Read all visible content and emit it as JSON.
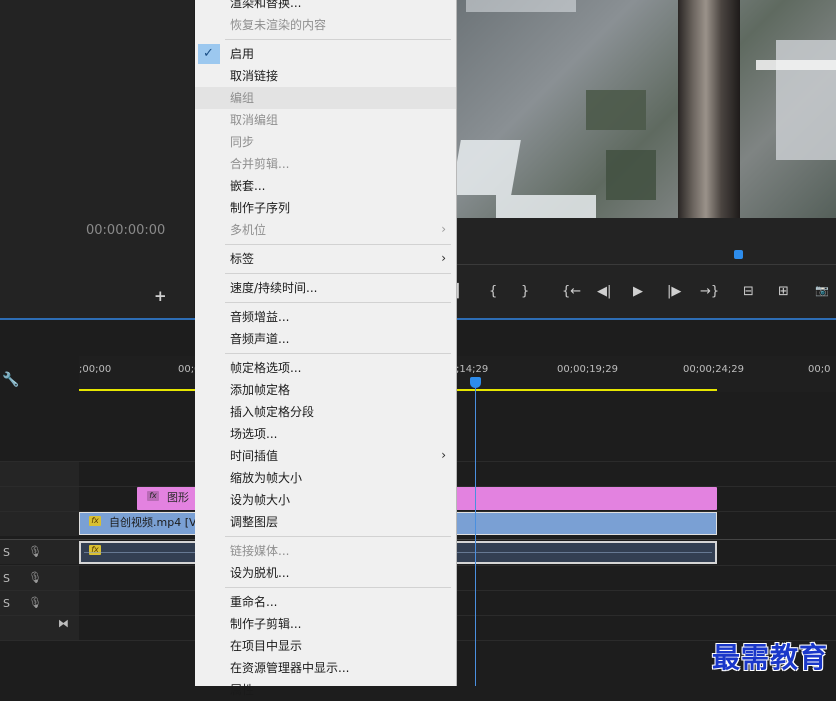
{
  "source_monitor": {
    "timecode": "00:00:00:00",
    "add_button": "+"
  },
  "program_monitor": {
    "buttons": [
      "{",
      "}",
      "{←",
      "◀|",
      "▶",
      "|▶",
      "→}",
      "⊟",
      "⊞",
      "📷"
    ]
  },
  "timeline": {
    "ruler_labels": [
      ";00;00",
      "00;0",
      ";14;29",
      "00;00;19;29",
      "00;00;24;29",
      "00;0"
    ],
    "tracks": {
      "audio_letters": [
        "S",
        "S",
        "S"
      ]
    },
    "clips": {
      "graphic": {
        "fx": "fx",
        "label": "图形"
      },
      "video": {
        "fx": "fx",
        "label": "自创视频.mp4 [V] ["
      },
      "audio": {
        "fx": "fx"
      }
    }
  },
  "context_menu": {
    "items": [
      {
        "label": "渲染和替换...",
        "disabled": false
      },
      {
        "label": "恢复未渲染的内容",
        "disabled": true
      },
      {
        "label": "启用",
        "disabled": false,
        "checked": true
      },
      {
        "label": "取消链接",
        "disabled": false
      },
      {
        "label": "编组",
        "disabled": true
      },
      {
        "label": "取消编组",
        "disabled": true
      },
      {
        "label": "同步",
        "disabled": true
      },
      {
        "label": "合并剪辑...",
        "disabled": true
      },
      {
        "label": "嵌套...",
        "disabled": false
      },
      {
        "label": "制作子序列",
        "disabled": false
      },
      {
        "label": "多机位",
        "disabled": true,
        "submenu": true
      },
      {
        "label": "标签",
        "disabled": false,
        "submenu": true
      },
      {
        "label": "速度/持续时间...",
        "disabled": false
      },
      {
        "label": "音频增益...",
        "disabled": false
      },
      {
        "label": "音频声道...",
        "disabled": false
      },
      {
        "label": "帧定格选项...",
        "disabled": false
      },
      {
        "label": "添加帧定格",
        "disabled": false
      },
      {
        "label": "插入帧定格分段",
        "disabled": false
      },
      {
        "label": "场选项...",
        "disabled": false
      },
      {
        "label": "时间插值",
        "disabled": false,
        "submenu": true
      },
      {
        "label": "缩放为帧大小",
        "disabled": false
      },
      {
        "label": "设为帧大小",
        "disabled": false
      },
      {
        "label": "调整图层",
        "disabled": false
      },
      {
        "label": "链接媒体...",
        "disabled": true
      },
      {
        "label": "设为脱机...",
        "disabled": false
      },
      {
        "label": "重命名...",
        "disabled": false
      },
      {
        "label": "制作子剪辑...",
        "disabled": false
      },
      {
        "label": "在项目中显示",
        "disabled": false
      },
      {
        "label": "在资源管理器中显示...",
        "disabled": false
      },
      {
        "label": "属性",
        "disabled": false
      }
    ],
    "submenu_arrow": "›",
    "check_mark": "✓"
  },
  "watermark": "最需教育",
  "colors": {
    "accent_blue": "#2d8ceb",
    "graphic_clip": "#e382e0",
    "video_clip": "#7aa0d4"
  }
}
